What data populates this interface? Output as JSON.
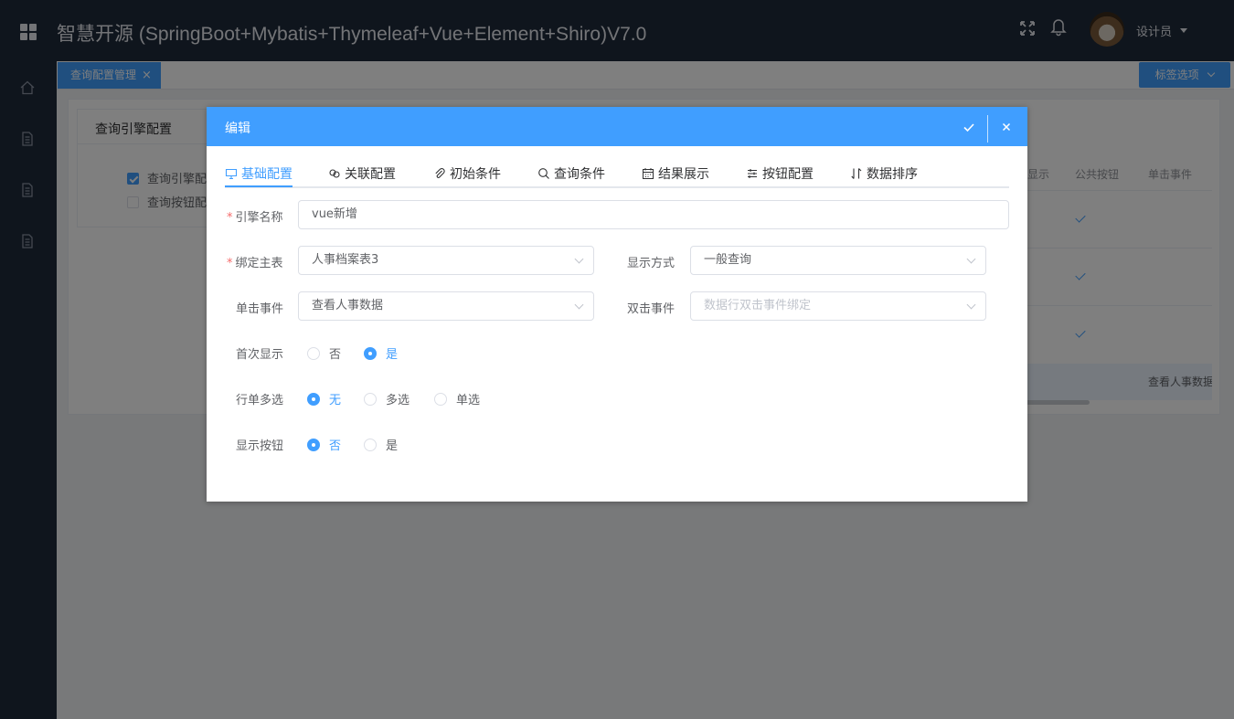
{
  "app": {
    "title": "智慧开源 (SpringBoot+Mybatis+Thymeleaf+Vue+Element+Shiro)V7.0",
    "user_name": "设计员"
  },
  "header_icons": [
    "fullscreen-icon",
    "bell-icon"
  ],
  "sidebar": {
    "icons": [
      "home-icon",
      "document-icon",
      "document-icon",
      "document-icon"
    ]
  },
  "tabbar": {
    "active_tab": "查询配置管理",
    "close_glyph": "×",
    "options_label": "标签选项"
  },
  "background_page": {
    "panel_title": "查询引擎配置",
    "tree_items": [
      {
        "label": "查询引擎配",
        "checked": true
      },
      {
        "label": "查询按钮配",
        "checked": false
      }
    ],
    "table_headers": [
      "显示",
      "公共按钮",
      "单击事件"
    ],
    "row_checks": [
      true,
      true,
      true
    ],
    "footer_text": "查看人事数据"
  },
  "dialog": {
    "title": "编辑",
    "tabs": [
      {
        "label": "基础配置",
        "icon": "monitor-icon",
        "active": true
      },
      {
        "label": "关联配置",
        "icon": "link-icon",
        "active": false
      },
      {
        "label": "初始条件",
        "icon": "paperclip-icon",
        "active": false
      },
      {
        "label": "查询条件",
        "icon": "search-icon",
        "active": false
      },
      {
        "label": "结果展示",
        "icon": "calendar-icon",
        "active": false
      },
      {
        "label": "按钮配置",
        "icon": "sliders-icon",
        "active": false
      },
      {
        "label": "数据排序",
        "icon": "sort-icon",
        "active": false
      }
    ],
    "form": {
      "engine_name": {
        "label": "引擎名称",
        "required": true,
        "value": "vue新增"
      },
      "bind_table": {
        "label": "绑定主表",
        "required": true,
        "value": "人事档案表3"
      },
      "display_mode": {
        "label": "显示方式",
        "value": "一般查询"
      },
      "click_event": {
        "label": "单击事件",
        "value": "查看人事数据"
      },
      "dblclick_event": {
        "label": "双击事件",
        "placeholder": "数据行双击事件绑定"
      },
      "first_show": {
        "label": "首次显示",
        "options": [
          "否",
          "是"
        ],
        "selected": "是"
      },
      "row_select": {
        "label": "行单多选",
        "options": [
          "无",
          "多选",
          "单选"
        ],
        "selected": "无"
      },
      "show_buttons": {
        "label": "显示按钮",
        "options": [
          "否",
          "是"
        ],
        "selected": "否"
      }
    }
  },
  "colors": {
    "primary": "#409eff",
    "header_bg": "#1f2a3a",
    "required": "#f56c6c",
    "overlay": "rgba(0,0,0,0.5)"
  }
}
